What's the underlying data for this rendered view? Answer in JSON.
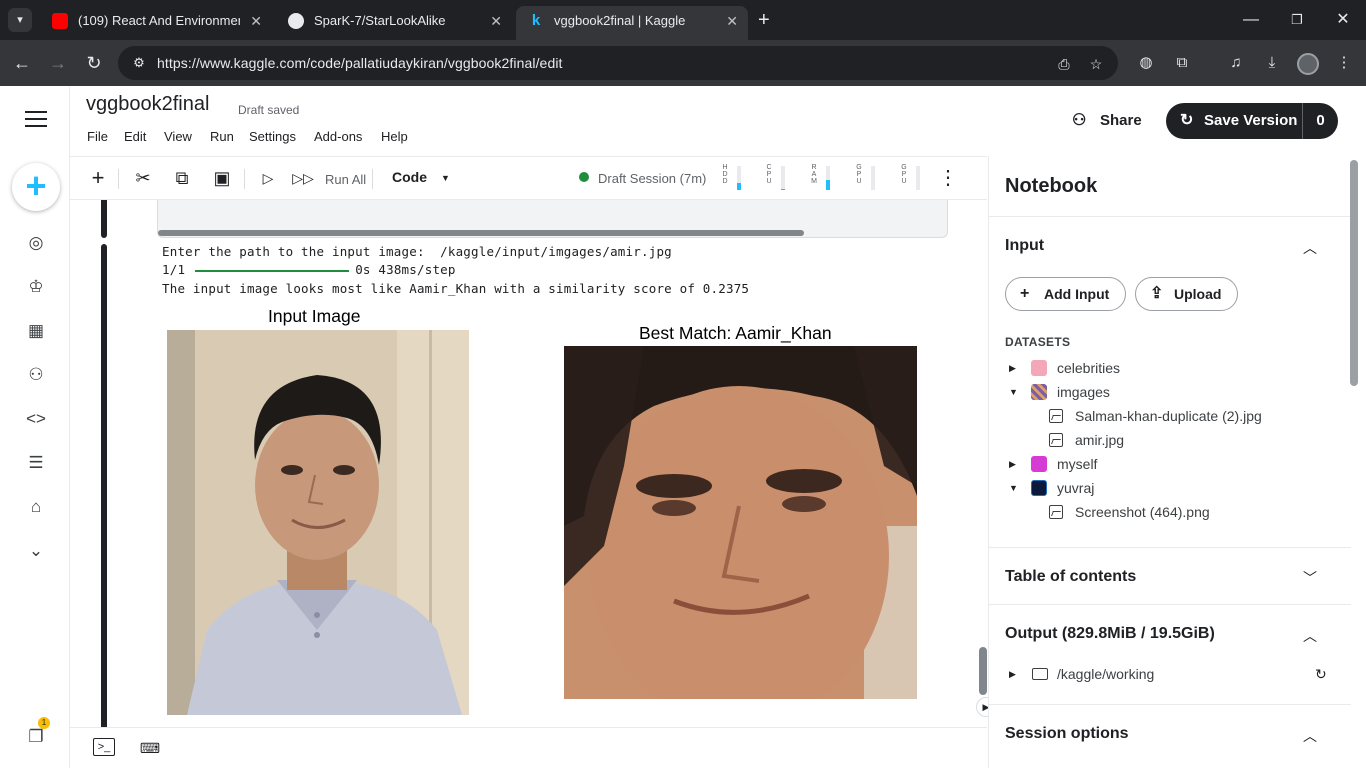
{
  "browser": {
    "tabs": [
      {
        "label": "(109) React And Environment Se",
        "favicon": "youtube-icon",
        "active": false
      },
      {
        "label": "SparK-7/StarLookAlike",
        "favicon": "github-icon",
        "active": false
      },
      {
        "label": "vggbook2final | Kaggle",
        "favicon": "kaggle-icon",
        "active": true
      }
    ],
    "url": "https://www.kaggle.com/code/pallatiudaykiran/vggbook2final/edit"
  },
  "header": {
    "title": "vggbook2final",
    "status": "Draft saved",
    "menu": [
      "File",
      "Edit",
      "View",
      "Run",
      "Settings",
      "Add-ons",
      "Help"
    ],
    "share_label": "Share",
    "save_version_label": "Save Version",
    "save_version_count": "0"
  },
  "rail": {
    "icons": [
      "menu-icon",
      "create-icon",
      "compass-icon",
      "trophy-icon",
      "table-icon",
      "models-icon",
      "code-icon",
      "comments-icon",
      "learn-icon",
      "chevron-down-icon",
      "notifications-icon"
    ],
    "badge": "1"
  },
  "toolbar": {
    "run_all": "Run All",
    "cell_type": "Code",
    "session": "Draft Session (7m)",
    "meters": [
      {
        "label": "HDD",
        "fill": 0.3
      },
      {
        "label": "CPU",
        "fill": 0.05
      },
      {
        "label": "RAM",
        "fill": 0.4
      },
      {
        "label": "GPU",
        "fill": 0.0
      },
      {
        "label": "GPU",
        "fill": 0.0
      }
    ]
  },
  "output": {
    "line1": "Enter the path to the input image:  /kaggle/input/imgages/amir.jpg",
    "progress_prefix": "1/1",
    "progress_suffix": "0s 438ms/step",
    "line3": "The input image looks most like Aamir_Khan with a similarity score of 0.2375",
    "fig_left_title": "Input Image",
    "fig_right_title": "Best Match: Aamir_Khan"
  },
  "panel": {
    "title": "Notebook",
    "input_section": "Input",
    "add_input": "Add Input",
    "upload": "Upload",
    "datasets_label": "DATASETS",
    "datasets": [
      {
        "name": "celebrities",
        "expanded": false,
        "color": "#f4a7b9",
        "files": []
      },
      {
        "name": "imgages",
        "expanded": true,
        "color": "#7b5ea7",
        "files": [
          "Salman-khan-duplicate (2).jpg",
          "amir.jpg"
        ]
      },
      {
        "name": "myself",
        "expanded": false,
        "color": "#d63bd6",
        "files": []
      },
      {
        "name": "yuvraj",
        "expanded": true,
        "color": "#0b1a3a",
        "files": [
          "Screenshot (464).png"
        ]
      }
    ],
    "toc_section": "Table of contents",
    "output_section": "Output (829.8MiB / 19.5GiB)",
    "output_folder": "/kaggle/working",
    "session_section": "Session options"
  },
  "colors": {
    "kaggle_blue": "#20beff",
    "session_green": "#1e8e3e",
    "dark": "#202124"
  }
}
